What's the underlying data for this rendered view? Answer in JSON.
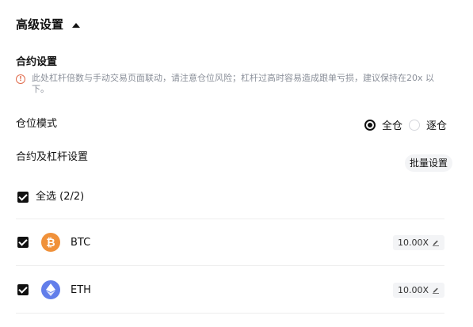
{
  "section": {
    "title": "高级设置"
  },
  "contract": {
    "title": "合约设置",
    "warning": "此处杠杆倍数与手动交易页面联动，请注意仓位风险；杠杆过高时容易造成跟单亏损，建议保持在20x 以下。"
  },
  "position_mode": {
    "label": "仓位模式",
    "options": [
      {
        "label": "全仓",
        "selected": true
      },
      {
        "label": "逐仓",
        "selected": false
      }
    ]
  },
  "leverage": {
    "label": "合约及杠杆设置",
    "batch_button": "批量设置",
    "select_all": "全选 (2/2)",
    "items": [
      {
        "symbol": "BTC",
        "glyph": "₿",
        "color": "#f0913a",
        "leverage": "10.00X",
        "checked": true
      },
      {
        "symbol": "ETH",
        "glyph": "◆",
        "color": "#627eea",
        "leverage": "10.00X",
        "checked": true
      }
    ]
  },
  "colors": {
    "accent": "#111111",
    "warning": "#e06a4b",
    "muted": "#8a8f99"
  }
}
